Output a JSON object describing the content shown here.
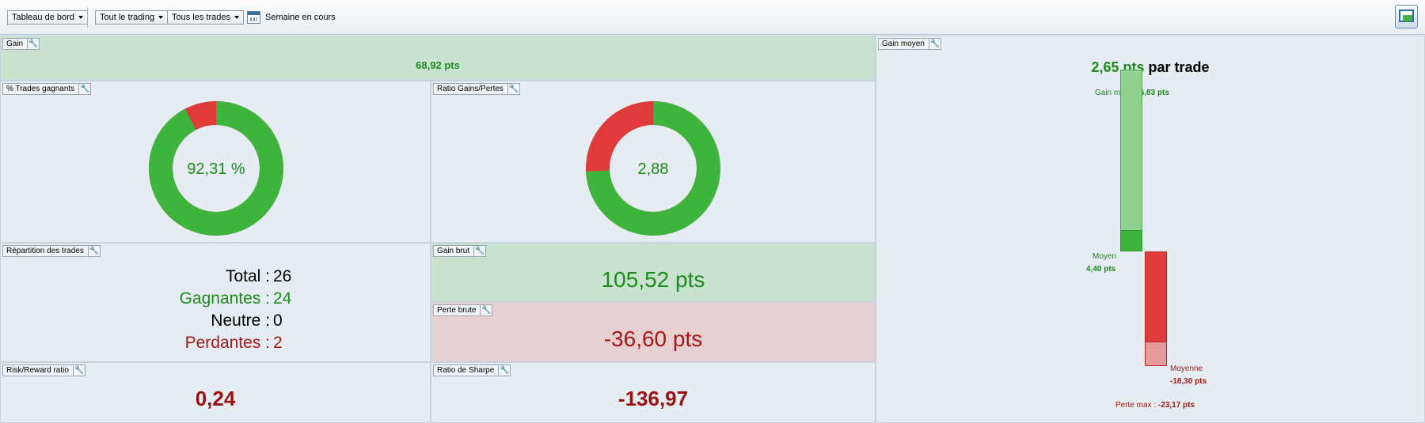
{
  "toolbar": {
    "dashboard": "Tableau de bord",
    "trading": "Tout le trading",
    "trades": "Tous les trades",
    "week": "Semaine en cours"
  },
  "gain": {
    "label": "Gain",
    "value": "68,92 pts"
  },
  "win_pct": {
    "label": "% Trades gagnants",
    "value": "92,31 %",
    "fraction_green": 0.9231
  },
  "ratio": {
    "label": "Ratio Gains/Pertes",
    "value": "2,88",
    "fraction_green": 0.7424
  },
  "repartition": {
    "label": "Répartition des trades",
    "rows": [
      {
        "label": "Total :",
        "value": "26",
        "color": "#000000"
      },
      {
        "label": "Gagnantes :",
        "value": "24",
        "color": "#1e8a1e"
      },
      {
        "label": "Neutre :",
        "value": "0",
        "color": "#000000"
      },
      {
        "label": "Perdantes :",
        "value": "2",
        "color": "#a31818"
      }
    ]
  },
  "gain_brut": {
    "label": "Gain brut",
    "value": "105,52 pts"
  },
  "perte_brute": {
    "label": "Perte brute",
    "value": "-36,60 pts"
  },
  "risk_reward": {
    "label": "Risk/Reward ratio",
    "value": "0,24"
  },
  "sharpe": {
    "label": "Ratio de Sharpe",
    "value": "-136,97"
  },
  "gain_moyen": {
    "label": "Gain moyen",
    "value": "2,65 pts",
    "suffix": "par trade",
    "gain_max_label": "Gain max :",
    "gain_max_value": "36,83 pts",
    "gain_max": 36.83,
    "moyen_label": "Moyen",
    "moyen_value": "4,40 pts",
    "moyen": 4.4,
    "moyenne_label": "Moyenne",
    "moyenne_value": "-18,30 pts",
    "moyenne": -18.3,
    "perte_max_label": "Perte max :",
    "perte_max_value": "-23,17 pts",
    "perte_max": -23.17
  },
  "colors": {
    "green": "#3db53d",
    "red": "#e03b3b",
    "light_green": "#8fd18f",
    "light_red": "#e89a9a"
  }
}
